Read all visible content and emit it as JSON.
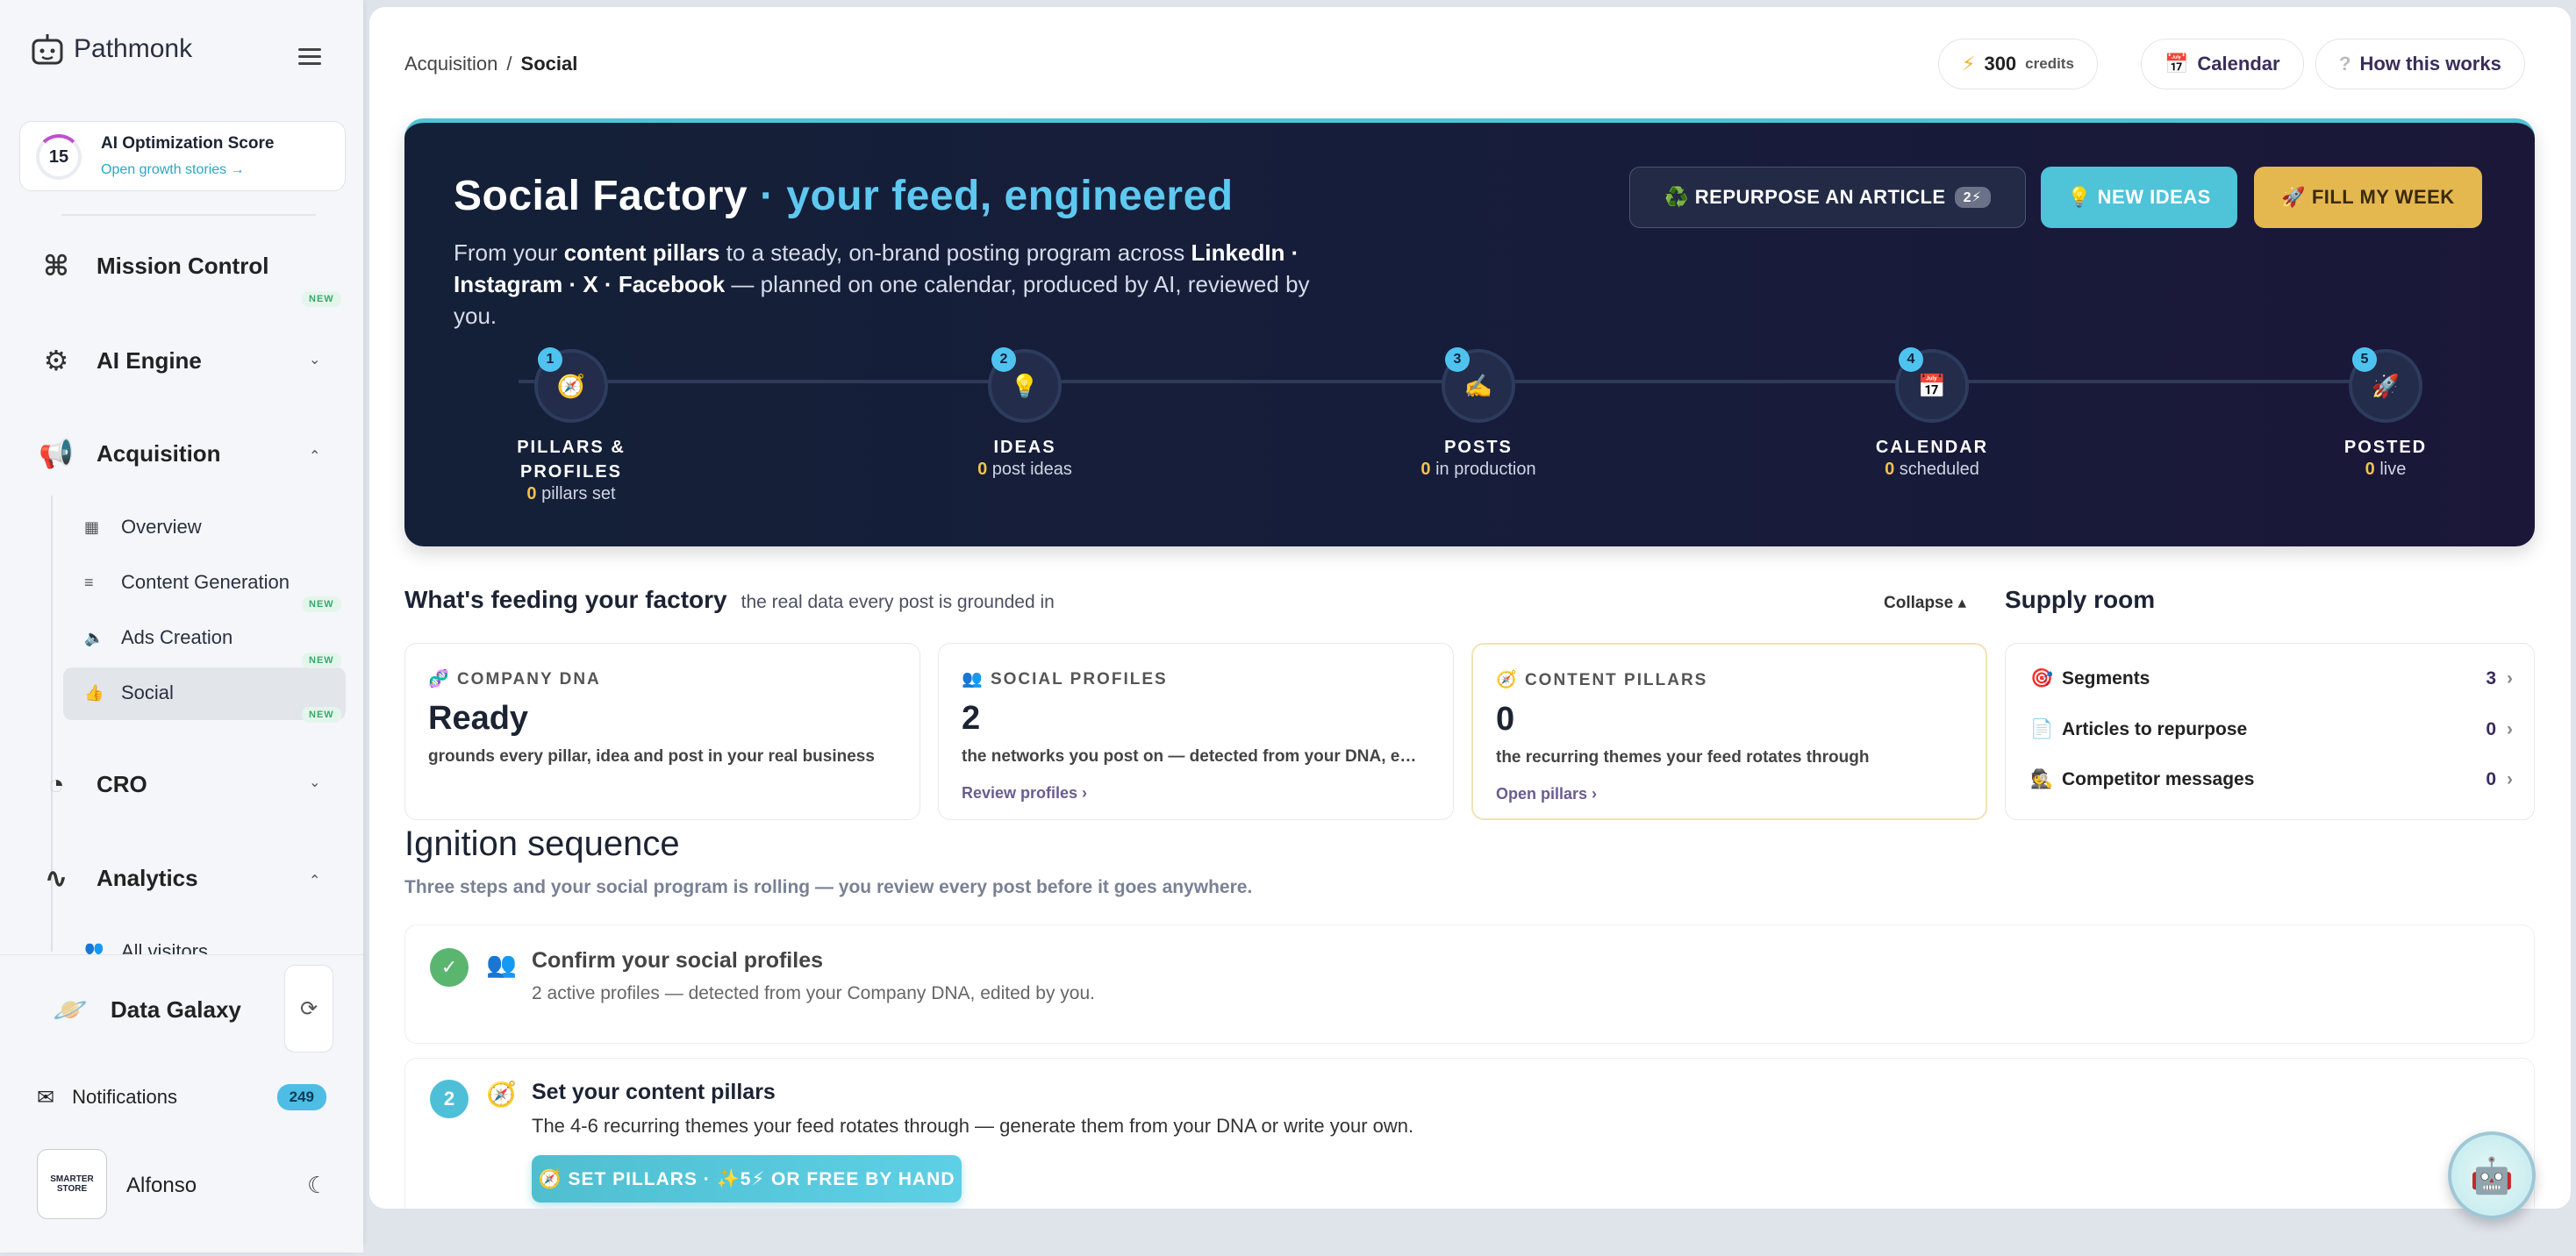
{
  "sidebar": {
    "brand": "Pathmonk",
    "score": {
      "value": "15",
      "title": "AI Optimization Score",
      "link": "Open growth stories →"
    },
    "mission": "Mission Control",
    "new": "NEW",
    "ai_engine": "AI Engine",
    "acquisition": "Acquisition",
    "items": [
      {
        "label": "Overview"
      },
      {
        "label": "Content Generation"
      },
      {
        "label": "Ads Creation"
      },
      {
        "label": "Social"
      }
    ],
    "cro": "CRO",
    "analytics": "Analytics",
    "all_visitors": "All visitors",
    "data_galaxy": "Data Galaxy",
    "notifications": "Notifications",
    "notif_count": "249",
    "user": "Alfonso",
    "avatar_text1": "SMARTER",
    "avatar_text2": "STORE"
  },
  "header": {
    "crumb1": "Acquisition",
    "sep": "/",
    "crumb2": "Social",
    "credits": "300",
    "credits_label": "credits",
    "calendar": "Calendar",
    "how": "How this works"
  },
  "hero": {
    "title": "Social Factory",
    "title_accent": "· your feed, engineered",
    "d1": "From your ",
    "d2": "content pillars",
    "d3": " to a steady, on-brand posting program across ",
    "d4": "LinkedIn · Instagram · X · Facebook",
    "d5": " — planned on one calendar, produced by AI, reviewed by you.",
    "btn_repurpose": "♻️ REPURPOSE AN ARTICLE",
    "btn_repurpose_count": "2⚡",
    "btn_new": "💡 NEW IDEAS",
    "btn_fill": "🚀 FILL MY WEEK",
    "steps": [
      {
        "n": "1",
        "icon": "🧭",
        "label1": "PILLARS &",
        "label2": "PROFILES",
        "val": "0",
        "sub": " pillars set"
      },
      {
        "n": "2",
        "icon": "💡",
        "label1": "IDEAS",
        "label2": "",
        "val": "0",
        "sub": " post ideas"
      },
      {
        "n": "3",
        "icon": "✍️",
        "label1": "POSTS",
        "label2": "",
        "val": "0",
        "sub": " in production"
      },
      {
        "n": "4",
        "icon": "📅",
        "label1": "CALENDAR",
        "label2": "",
        "val": "0",
        "sub": " scheduled"
      },
      {
        "n": "5",
        "icon": "🚀",
        "label1": "POSTED",
        "label2": "",
        "val": "0",
        "sub": " live"
      }
    ]
  },
  "feeding": {
    "title": "What's feeding your factory",
    "sub": "the real data every post is grounded in",
    "collapse": "Collapse ▴",
    "cards": [
      {
        "icon": "🧬",
        "head": "COMPANY DNA",
        "big": "Ready",
        "desc": "grounds every pillar, idea and post in your real business",
        "link": ""
      },
      {
        "icon": "👥",
        "head": "SOCIAL PROFILES",
        "big": "2",
        "desc": "the networks you post on — detected from your DNA, e…",
        "link": "Review profiles ›"
      },
      {
        "icon": "🧭",
        "head": "CONTENT PILLARS",
        "big": "0",
        "desc": "the recurring themes your feed rotates through",
        "link": "Open pillars ›"
      }
    ]
  },
  "supply": {
    "title": "Supply room",
    "rows": [
      {
        "icon": "🎯",
        "label": "Segments",
        "val": "3"
      },
      {
        "icon": "📄",
        "label": "Articles to repurpose",
        "val": "0"
      },
      {
        "icon": "🕵️",
        "label": "Competitor messages",
        "val": "0"
      }
    ]
  },
  "ignition": {
    "title": "Ignition sequence",
    "sub": "Three steps and your social program is rolling — you review every post before it goes anywhere.",
    "s1_title": "Confirm your social profiles",
    "s1_desc": "2 active profiles — detected from your Company DNA, edited by you.",
    "s2_num": "2",
    "s2_title": "Set your content pillars",
    "s2_desc": "The 4-6 recurring themes your feed rotates through — generate them from your DNA or write your own.",
    "s2_btn": "🧭 SET PILLARS · ✨5⚡ OR FREE BY HAND"
  }
}
